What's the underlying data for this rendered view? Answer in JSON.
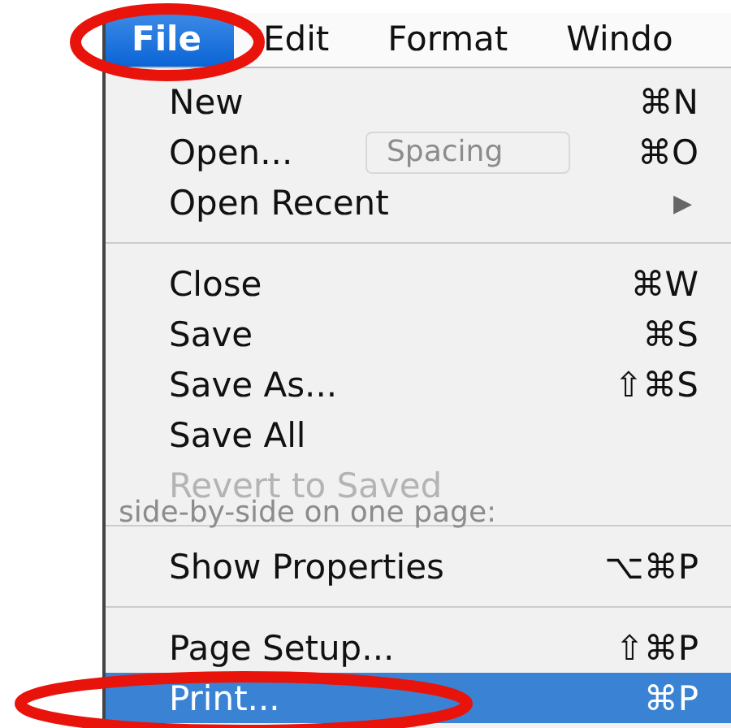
{
  "menubar": [
    {
      "label": "File",
      "selected": true,
      "annotated": true
    },
    {
      "label": "Edit",
      "selected": false,
      "annotated": false
    },
    {
      "label": "Format",
      "selected": false,
      "annotated": false
    },
    {
      "label": "Windo",
      "selected": false,
      "annotated": false
    }
  ],
  "background": {
    "spacing_field": "Spacing",
    "caption": "side-by-side on one page:"
  },
  "menu": [
    {
      "kind": "item",
      "label": "New",
      "shortcut": "⌘N",
      "disabled": false,
      "selected": false,
      "annotated": false
    },
    {
      "kind": "item",
      "label": "Open...",
      "shortcut": "⌘O",
      "disabled": false,
      "selected": false,
      "annotated": false
    },
    {
      "kind": "submenu",
      "label": "Open Recent",
      "arrow": "▶",
      "disabled": false,
      "selected": false,
      "annotated": false
    },
    {
      "kind": "separator"
    },
    {
      "kind": "item",
      "label": "Close",
      "shortcut": "⌘W",
      "disabled": false,
      "selected": false,
      "annotated": false
    },
    {
      "kind": "item",
      "label": "Save",
      "shortcut": "⌘S",
      "disabled": false,
      "selected": false,
      "annotated": false
    },
    {
      "kind": "item",
      "label": "Save As...",
      "shortcut": "⇧⌘S",
      "disabled": false,
      "selected": false,
      "annotated": false
    },
    {
      "kind": "item",
      "label": "Save All",
      "disabled": false,
      "selected": false,
      "annotated": false
    },
    {
      "kind": "item",
      "label": "Revert to Saved",
      "disabled": true,
      "selected": false,
      "annotated": false
    },
    {
      "kind": "separator"
    },
    {
      "kind": "item",
      "label": "Show Properties",
      "shortcut": "⌥⌘P",
      "disabled": false,
      "selected": false,
      "annotated": false
    },
    {
      "kind": "separator"
    },
    {
      "kind": "item",
      "label": "Page Setup...",
      "shortcut": "⇧⌘P",
      "disabled": false,
      "selected": false,
      "annotated": false
    },
    {
      "kind": "item",
      "label": "Print...",
      "shortcut": "⌘P",
      "disabled": false,
      "selected": true,
      "annotated": true
    }
  ]
}
